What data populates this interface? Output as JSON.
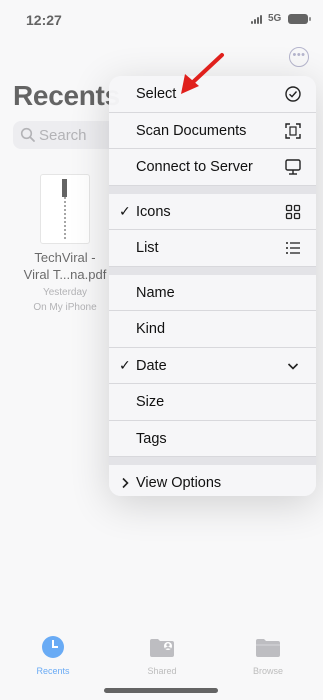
{
  "status_bar": {
    "time": "12:27",
    "network": "5G"
  },
  "page": {
    "title": "Recents",
    "search": {
      "placeholder": "Search"
    },
    "file": {
      "name": "TechViral - Viral T...na.pdf",
      "date": "Yesterday",
      "location": "On My iPhone"
    }
  },
  "menu": {
    "group1": [
      {
        "label": "Select",
        "icon": "checkmark-circle-icon"
      },
      {
        "label": "Scan Documents",
        "icon": "scan-document-icon"
      },
      {
        "label": "Connect to Server",
        "icon": "server-icon"
      }
    ],
    "group2": [
      {
        "label": "Icons",
        "icon": "grid-icon",
        "checked": true
      },
      {
        "label": "List",
        "icon": "list-icon",
        "checked": false
      }
    ],
    "group3": [
      {
        "label": "Name"
      },
      {
        "label": "Kind"
      },
      {
        "label": "Date",
        "checked": true,
        "icon": "chevron-down-icon"
      },
      {
        "label": "Size"
      },
      {
        "label": "Tags"
      }
    ],
    "group4": [
      {
        "label": "View Options",
        "icon": "chevron-right-icon"
      }
    ],
    "check_glyph": "✓",
    "chevron_right_glyph": "›"
  },
  "tab_bar": {
    "tabs": [
      {
        "label": "Recents",
        "icon": "clock-icon",
        "active": true
      },
      {
        "label": "Shared",
        "icon": "shared-folder-icon",
        "active": false
      },
      {
        "label": "Browse",
        "icon": "folder-icon",
        "active": false
      }
    ]
  },
  "colors": {
    "accent": "#1a7ef0",
    "annotation": "#e0201c"
  }
}
